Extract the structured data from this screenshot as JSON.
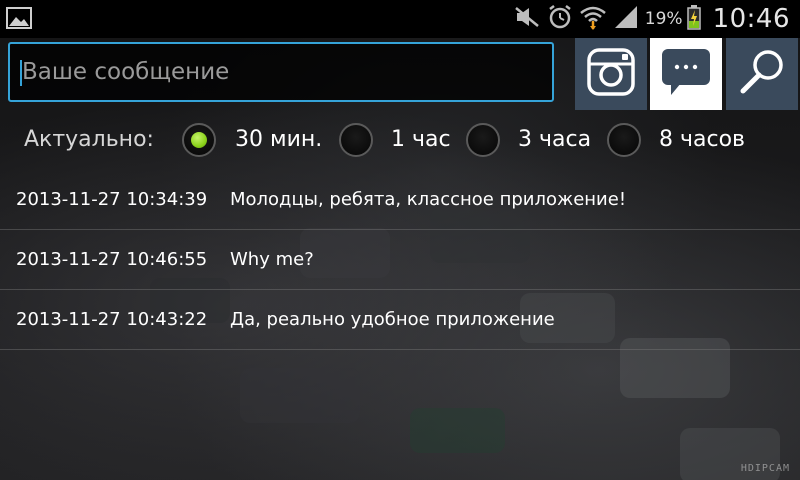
{
  "status_bar": {
    "battery_percent": "19%",
    "time": "10:46",
    "icons": [
      "gallery-icon",
      "mute-icon",
      "alarm-icon",
      "wifi-icon",
      "signal-icon",
      "battery-charging-icon"
    ]
  },
  "composer": {
    "placeholder": "Ваше сообщение",
    "value": "",
    "buttons": [
      "camera-icon",
      "chat-bubble-icon",
      "search-icon"
    ]
  },
  "relevance": {
    "label": "Актуально:",
    "options": [
      "30 мин.",
      "1 час",
      "3 часа",
      "8 часов"
    ],
    "selected": "30 мин."
  },
  "messages": [
    {
      "time": "2013-11-27 10:34:39",
      "text": "Молодцы, ребята, классное приложение!"
    },
    {
      "time": "2013-11-27 10:46:55",
      "text": "Why me?"
    },
    {
      "time": "2013-11-27 10:43:22",
      "text": "Да, реально удобное приложение"
    }
  ],
  "overlay": {
    "camera_watermark": "HDIPCAM"
  },
  "colors": {
    "accent": "#35a3d8",
    "button_bg": "#3a4a5c",
    "active_button_bg": "#ffffff",
    "radio_selected": "#8bd21a"
  }
}
